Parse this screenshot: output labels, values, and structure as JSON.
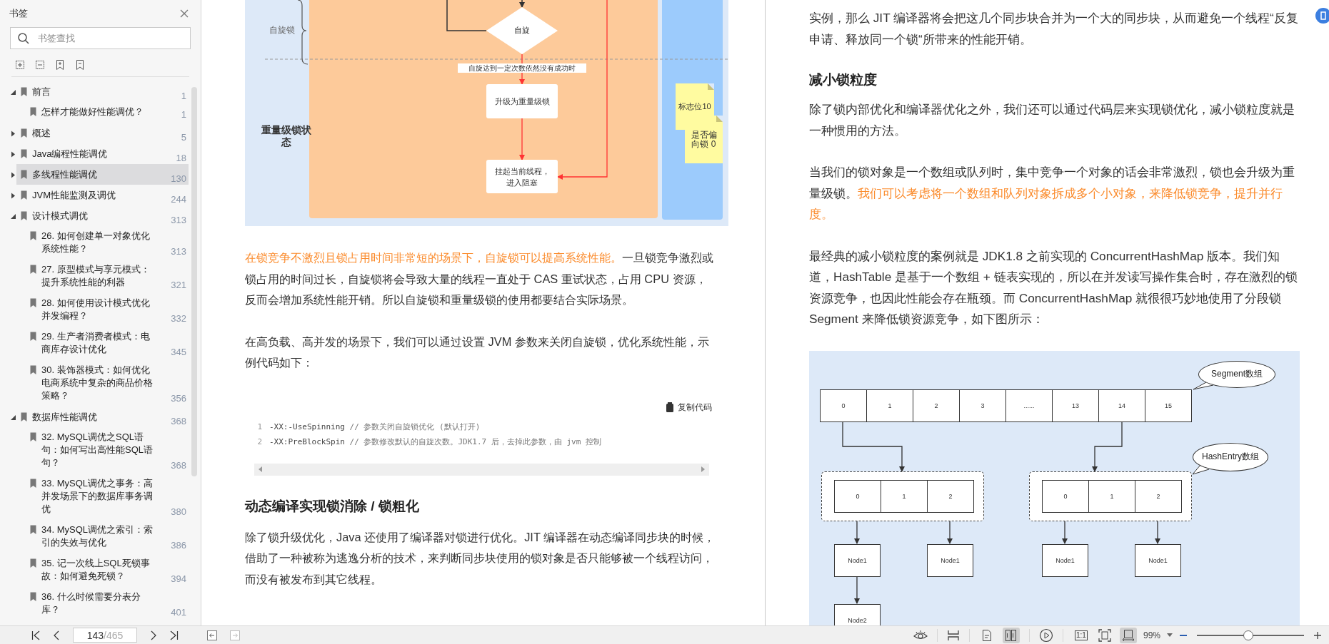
{
  "sidebar": {
    "title": "书签",
    "search": {
      "placeholder": "书签查找"
    },
    "bookmarks": [
      {
        "title": "前言",
        "page": "1",
        "expanded": true,
        "selected": false,
        "children": [
          {
            "title": "怎样才能做好性能调优？",
            "page": "1",
            "selected": false
          }
        ]
      },
      {
        "title": "概述",
        "page": "5",
        "expanded": false,
        "selected": false
      },
      {
        "title": "Java编程性能调优",
        "page": "18",
        "expanded": false,
        "selected": false
      },
      {
        "title": "多线程性能调优",
        "page": "130",
        "expanded": false,
        "selected": true
      },
      {
        "title": "JVM性能监测及调优",
        "page": "244",
        "expanded": false,
        "selected": false
      },
      {
        "title": "设计模式调优",
        "page": "313",
        "expanded": true,
        "selected": false,
        "children": [
          {
            "title": "26. 如何创建单一对象优化系统性能？",
            "page": "313",
            "selected": false
          },
          {
            "title": "27. 原型模式与享元模式：提升系统性能的利器",
            "page": "321",
            "selected": false
          },
          {
            "title": "28. 如何使用设计模式优化并发编程？",
            "page": "332",
            "selected": false
          },
          {
            "title": "29. 生产者消费者模式：电商库存设计优化",
            "page": "345",
            "selected": false
          },
          {
            "title": "30. 装饰器模式：如何优化电商系统中复杂的商品价格策略？",
            "page": "356",
            "selected": false
          }
        ]
      },
      {
        "title": "数据库性能调优",
        "page": "368",
        "expanded": true,
        "selected": false,
        "children": [
          {
            "title": "32. MySQL调优之SQL语句：如何写出高性能SQL语句？",
            "page": "368",
            "selected": false
          },
          {
            "title": "33. MySQL调优之事务：高并发场景下的数据库事务调优",
            "page": "380",
            "selected": false
          },
          {
            "title": "34. MySQL调优之索引：索引的失效与优化",
            "page": "386",
            "selected": false
          },
          {
            "title": "35. 记一次线上SQL死锁事故：如何避免死锁？",
            "page": "394",
            "selected": false
          },
          {
            "title": "36. 什么时候需要分表分库？",
            "page": "401",
            "selected": false
          }
        ]
      }
    ]
  },
  "left_page": {
    "blocks": [
      {
        "kind": "lock_flow",
        "brace_label": "自旋锁",
        "decision": "自旋",
        "edge_label": "自旋达到一定次数依然没有成功时",
        "steps": [
          "升级为重量级锁",
          "挂起当前线程，进入阻塞"
        ],
        "state_label": "重量级锁状态",
        "notes": [
          "标志位10",
          "是否偏向锁 0"
        ]
      },
      {
        "kind": "paragraph",
        "segments": [
          {
            "text": "在锁竞争不激烈且锁占用时间非常短的场景下，自旋锁可以提高系统性能。",
            "highlight": true
          },
          {
            "text": "一旦锁竞争激烈或锁占用的时间过长，自旋锁将会导致大量的线程一直处于 CAS 重试状态，占用 CPU 资源，反而会增加系统性能开销。所以自旋锁和重量级锁的使用都要结合实际场景。",
            "highlight": false
          }
        ]
      },
      {
        "kind": "paragraph",
        "segments": [
          {
            "text": "在高负载、高并发的场景下，我们可以通过设置 JVM 参数来关闭自旋锁，优化系统性能，示例代码如下：",
            "highlight": false
          }
        ]
      },
      {
        "kind": "code",
        "copy_label": "复制代码",
        "lines": [
          {
            "number": "1",
            "code": "-XX:-UseSpinning",
            "comment": "// 参数关闭自旋锁优化 (默认打开)"
          },
          {
            "number": "2",
            "code": "-XX:PreBlockSpin",
            "comment": "// 参数修改默认的自旋次数。JDK1.7 后，去掉此参数，由 jvm 控制"
          }
        ]
      },
      {
        "kind": "heading",
        "text": "动态编译实现锁消除 / 锁粗化"
      },
      {
        "kind": "paragraph",
        "segments": [
          {
            "text": "除了锁升级优化，Java 还使用了编译器对锁进行优化。JIT 编译器在动态编译同步块的时候，借助了一种被称为逃逸分析的技术，来判断同步块使用的锁对象是否只能够被一个线程访问，而没有被发布到其它线程。",
            "highlight": false
          }
        ]
      }
    ]
  },
  "right_page": {
    "blocks": [
      {
        "kind": "paragraph",
        "segments": [
          {
            "text": "实例，那么 JIT 编译器将会把这几个同步块合并为一个大的同步块，从而避免一个线程“反复申请、释放同一个锁“所带来的性能开销。",
            "highlight": false
          }
        ]
      },
      {
        "kind": "heading",
        "text": "减小锁粒度"
      },
      {
        "kind": "paragraph",
        "segments": [
          {
            "text": "除了锁内部优化和编译器优化之外，我们还可以通过代码层来实现锁优化，减小锁粒度就是一种惯用的方法。",
            "highlight": false
          }
        ]
      },
      {
        "kind": "paragraph",
        "segments": [
          {
            "text": "当我们的锁对象是一个数组或队列时，集中竞争一个对象的话会非常激烈，锁也会升级为重量级锁。",
            "highlight": false
          },
          {
            "text": "我们可以考虑将一个数组和队列对象拆成多个小对象，来降低锁竞争，提升并行度。",
            "highlight": true
          }
        ]
      },
      {
        "kind": "paragraph",
        "segments": [
          {
            "text": "最经典的减小锁粒度的案例就是 JDK1.8 之前实现的 ConcurrentHashMap 版本。我们知道，HashTable 是基于一个数组 + 链表实现的，所以在并发读写操作集合时，存在激烈的锁资源竞争，也因此性能会存在瓶颈。而 ConcurrentHashMap 就很很巧妙地使用了分段锁 Segment 来降低锁资源竞争，如下图所示：",
            "highlight": false
          }
        ]
      },
      {
        "kind": "segment_map",
        "segments": [
          "0",
          "1",
          "2",
          "3",
          "......",
          "13",
          "14",
          "15"
        ],
        "segment_callout": "Segment数组",
        "entry_callout": "HashEntry数组",
        "tables": [
          {
            "entries": [
              "0",
              "1",
              "2"
            ],
            "nodes": [
              {
                "label": "Node1",
                "next": "Node2"
              },
              {
                "label": "Node1"
              }
            ]
          },
          {
            "entries": [
              "0",
              "1",
              "2"
            ],
            "nodes": [
              {
                "label": "Node1"
              },
              {
                "label": "Node1"
              }
            ]
          }
        ]
      }
    ]
  },
  "status_bar": {
    "page_input": {
      "value": "143",
      "total": "/465"
    },
    "view_buttons": [
      {
        "kind": "single",
        "selected": false
      },
      {
        "kind": "double",
        "selected": true
      }
    ],
    "fit_buttons": [
      {
        "kind": "actual",
        "label": "1:1",
        "selected": false
      },
      {
        "kind": "page",
        "selected": false
      },
      {
        "kind": "width",
        "selected": true
      }
    ],
    "zoom": {
      "reading": "99%",
      "level": 0.48
    }
  }
}
